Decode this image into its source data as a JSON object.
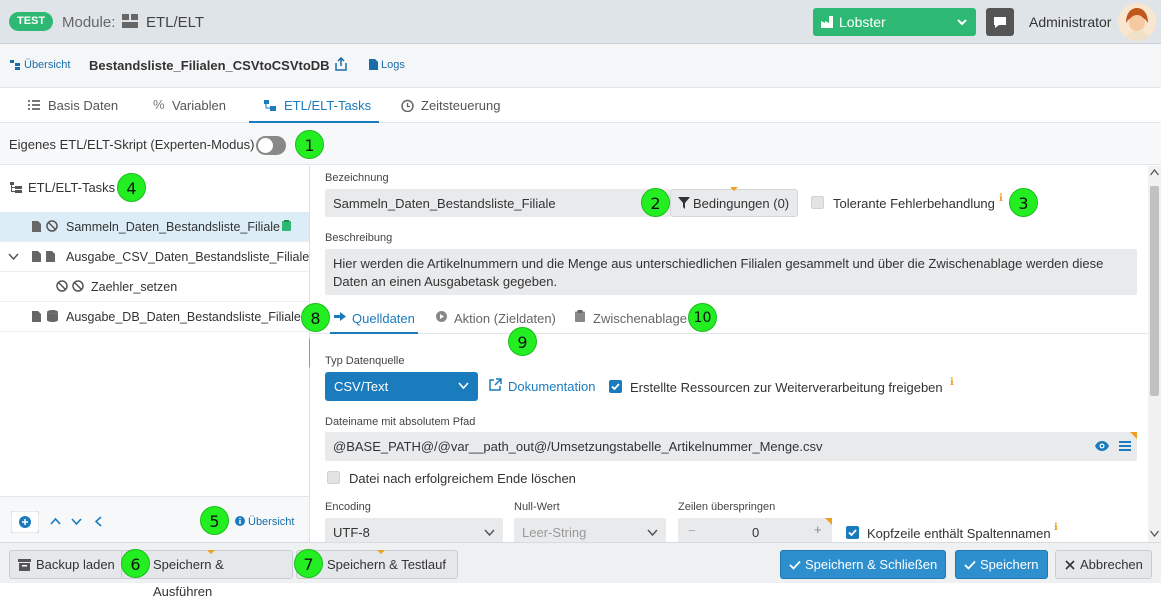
{
  "header": {
    "env_badge": "TEST",
    "module_label": "Module:",
    "module_name": "ETL/ELT",
    "mandant": "Lobster",
    "user": "Administrator"
  },
  "subheader": {
    "overview": "Übersicht",
    "title": "Bestandsliste_Filialen_CSVtoCSVtoDB",
    "logs": "Logs"
  },
  "tabs": [
    "Basis Daten",
    "Variablen",
    "ETL/ELT-Tasks",
    "Zeitsteuerung"
  ],
  "expert": {
    "label": "Eigenes ETL/ELT-Skript (Experten-Modus)"
  },
  "tree": {
    "header": "ETL/ELT-Tasks",
    "items": [
      "Sammeln_Daten_Bestandsliste_Filiale",
      "Ausgabe_CSV_Daten_Bestandsliste_Filiale",
      "Zaehler_setzen",
      "Ausgabe_DB_Daten_Bestandsliste_Filiale"
    ],
    "overview_link": "Übersicht"
  },
  "form": {
    "bezeichnung_label": "Bezeichnung",
    "bezeichnung_value": "Sammeln_Daten_Bestandsliste_Filiale",
    "bedingungen": "Bedingungen (0)",
    "tolerante": "Tolerante Fehlerbehandlung",
    "beschreibung_label": "Beschreibung",
    "beschreibung_value": "Hier werden die Artikelnummern und die Menge aus unterschiedlichen Filialen gesammelt und über die Zwischenablage werden diese Daten an einen Ausgabetask gegeben.",
    "subtabs": [
      "Quelldaten",
      "Aktion (Zieldaten)",
      "Zwischenablage"
    ],
    "typ_label": "Typ Datenquelle",
    "typ_value": "CSV/Text",
    "doku": "Dokumentation",
    "freigeben": "Erstellte Ressourcen zur Weiterverarbeitung freigeben",
    "pfad_label": "Dateiname mit absolutem Pfad",
    "pfad_value": "@BASE_PATH@/@var__path_out@/Umsetzungstabelle_Artikelnummer_Menge.csv",
    "loeschen": "Datei nach erfolgreichem Ende löschen",
    "encoding_label": "Encoding",
    "encoding_value": "UTF-8",
    "null_label": "Null-Wert",
    "null_value": "Leer-String",
    "zeilen_label": "Zeilen überspringen",
    "zeilen_minus": "−",
    "zeilen_value": "0",
    "zeilen_plus": "+",
    "kopfzeile": "Kopfzeile enthält Spaltennamen"
  },
  "bottom": {
    "backup": "Backup laden",
    "speichern_ausfuehren": "Speichern & Ausführen",
    "speichern_testlauf": "Speichern & Testlauf",
    "speichern_schliessen": "Speichern & Schließen",
    "speichern": "Speichern",
    "abbrechen": "Abbrechen"
  },
  "markers": [
    "1",
    "2",
    "3",
    "4",
    "5",
    "6",
    "7",
    "8",
    "9",
    "10"
  ]
}
